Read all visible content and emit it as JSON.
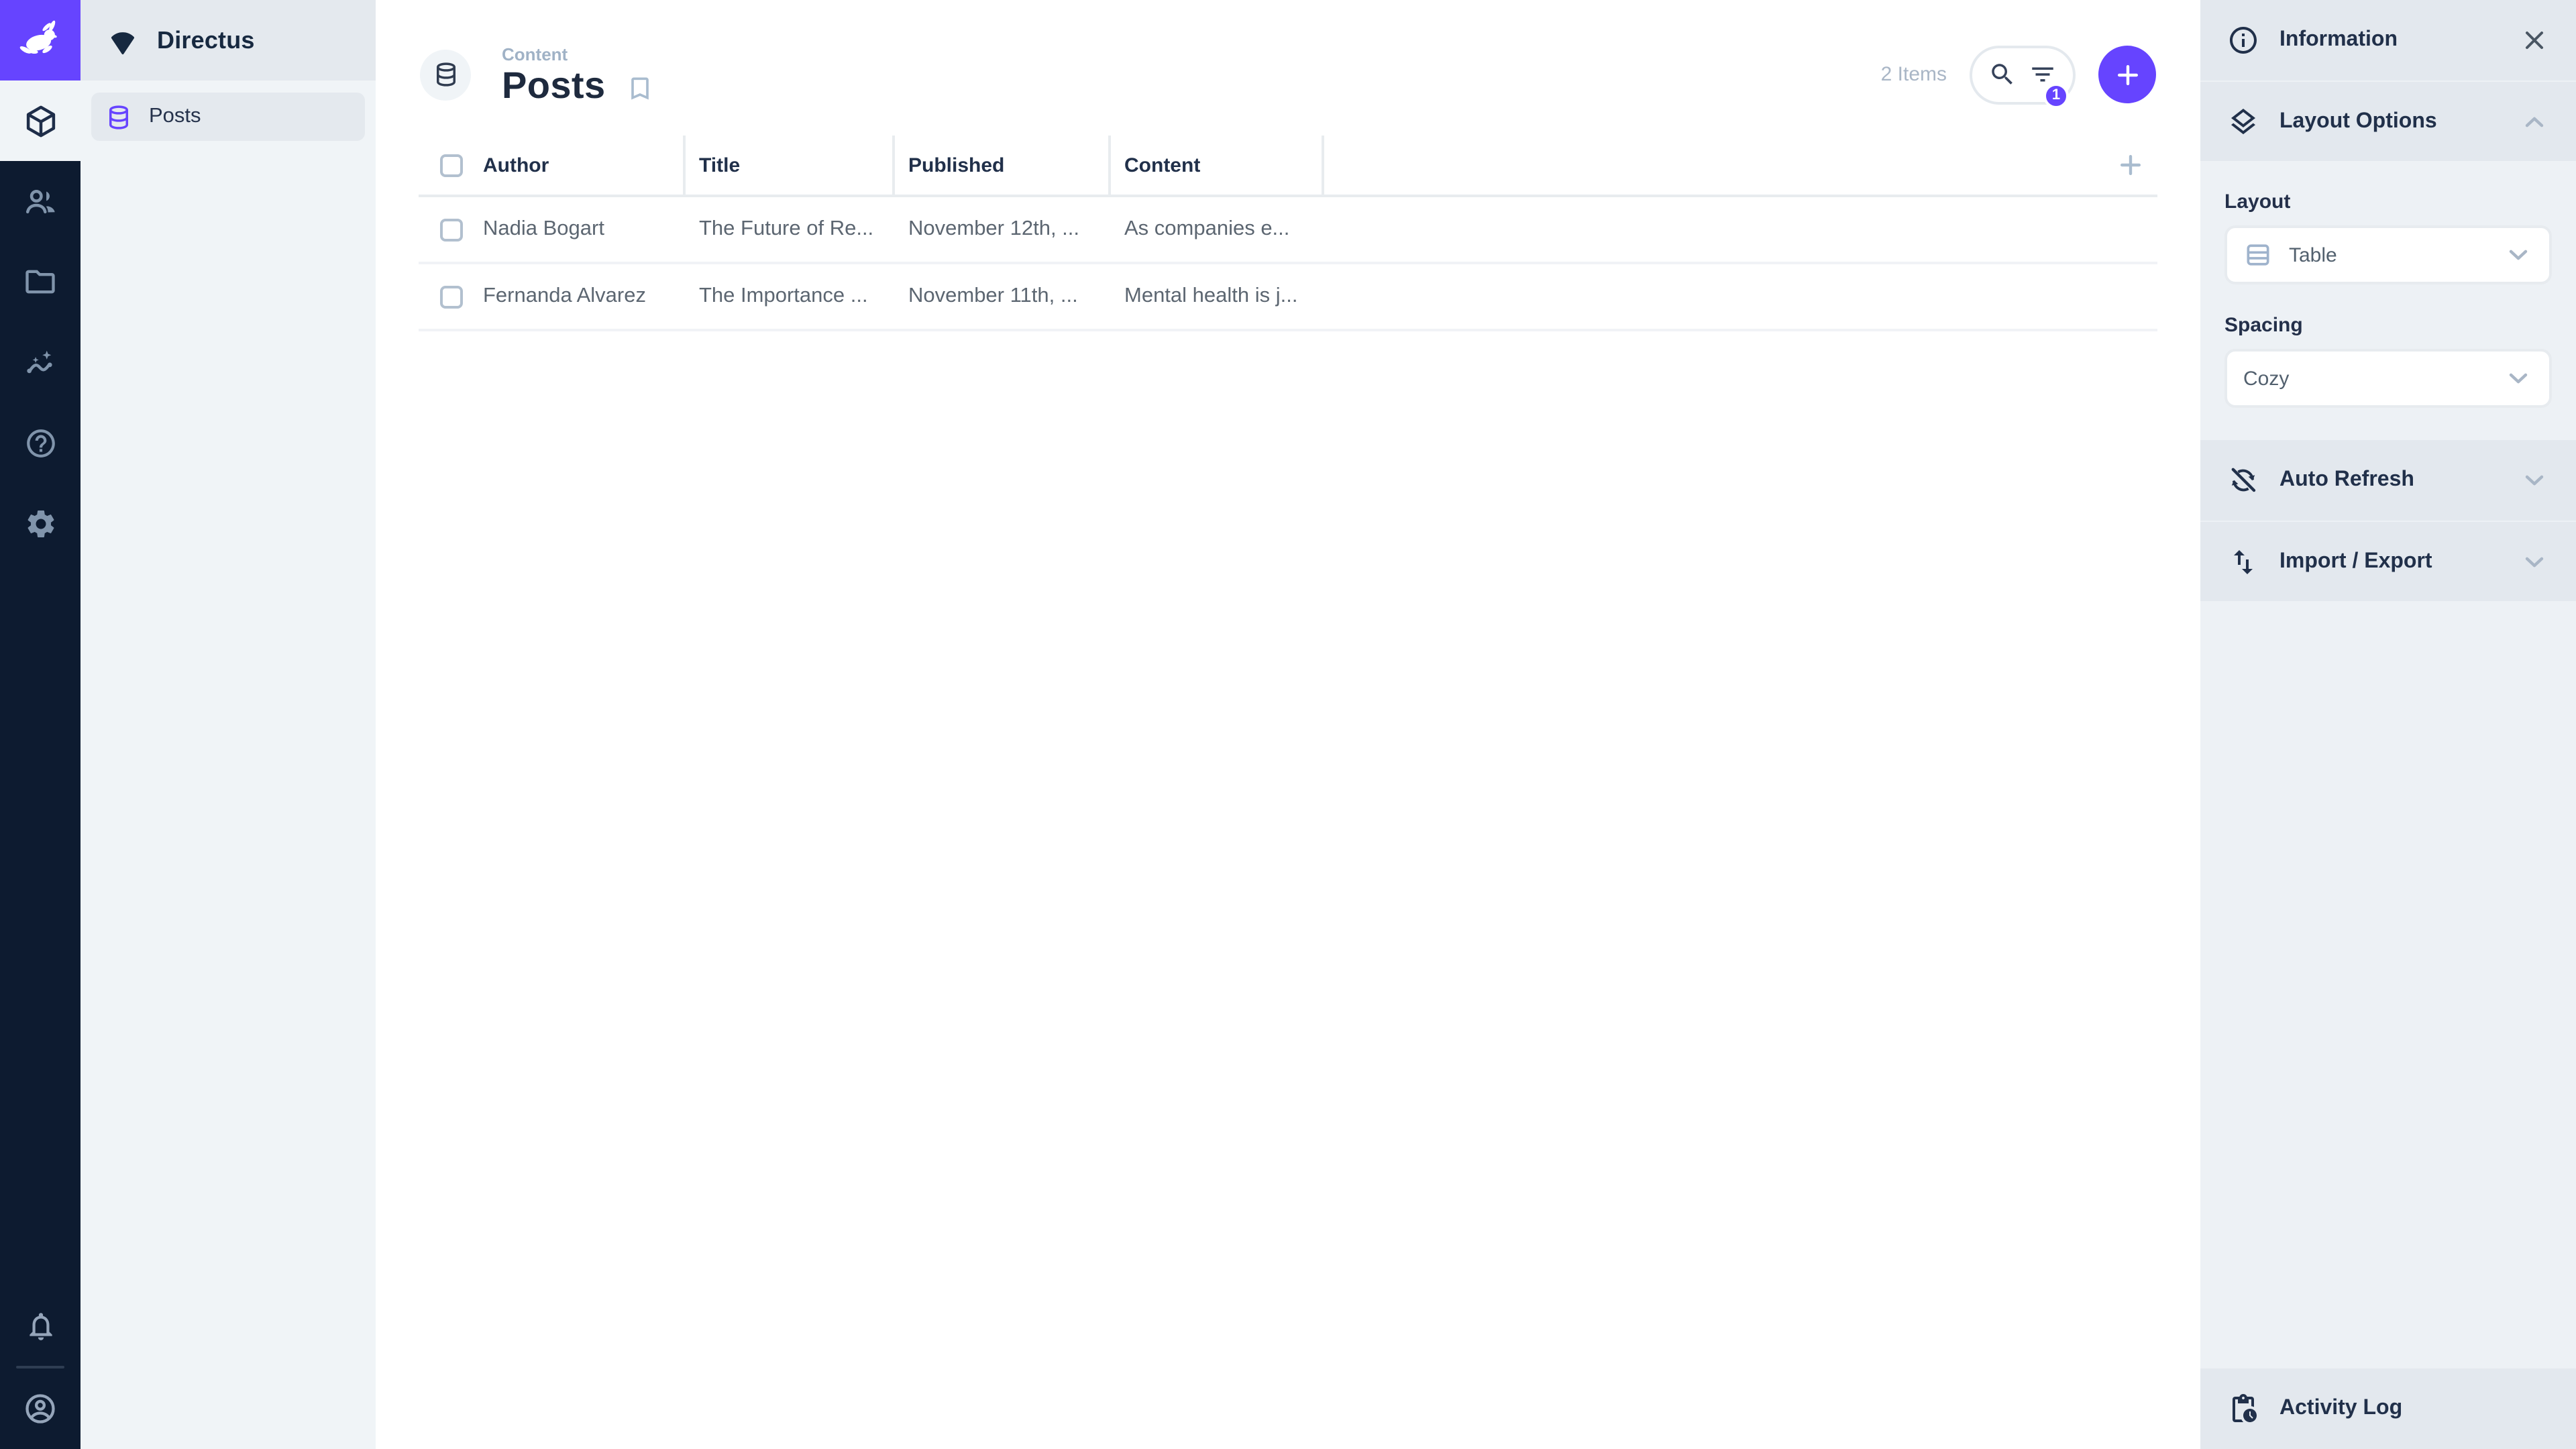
{
  "theme": {
    "accent": "#6644ff",
    "module_bar_bg": "#0d1b30",
    "nav_bg": "#f0f4f7",
    "nav_header_bg": "#e4e9ee",
    "sidebar_bg": "#edf1f5",
    "sidebar_section_bg": "#e3e8ee",
    "heading_color": "#1e2a3e",
    "text_color": "#5c6671",
    "muted_color": "#a9b6c6"
  },
  "module_bar": {
    "logo_icon": "directus-rabbit-icon",
    "modules": [
      "content",
      "users",
      "files",
      "insights",
      "help",
      "settings"
    ],
    "bottom": [
      "notifications",
      "account"
    ]
  },
  "nav": {
    "project_name": "Directus",
    "project_icon": "fan-icon",
    "items": [
      {
        "label": "Posts",
        "icon": "database-icon",
        "active": true
      }
    ]
  },
  "header": {
    "breadcrumb": "Content",
    "title": "Posts",
    "collection_icon": "database-icon",
    "item_count": "2 Items",
    "filter_badge": "1"
  },
  "table": {
    "columns": [
      "Author",
      "Title",
      "Published",
      "Content"
    ],
    "rows": [
      {
        "author": "Nadia Bogart",
        "title": "The Future of Re...",
        "published": "November 12th, ...",
        "content": "As companies e..."
      },
      {
        "author": "Fernanda Alvarez",
        "title": "The Importance ...",
        "published": "November 11th, ...",
        "content": "Mental health is j..."
      }
    ]
  },
  "sidebar": {
    "information": {
      "label": "Information"
    },
    "layout_options": {
      "label": "Layout Options",
      "layout_label": "Layout",
      "layout_value": "Table",
      "spacing_label": "Spacing",
      "spacing_value": "Cozy"
    },
    "auto_refresh": {
      "label": "Auto Refresh"
    },
    "import_export": {
      "label": "Import / Export"
    },
    "activity_log": {
      "label": "Activity Log"
    }
  }
}
